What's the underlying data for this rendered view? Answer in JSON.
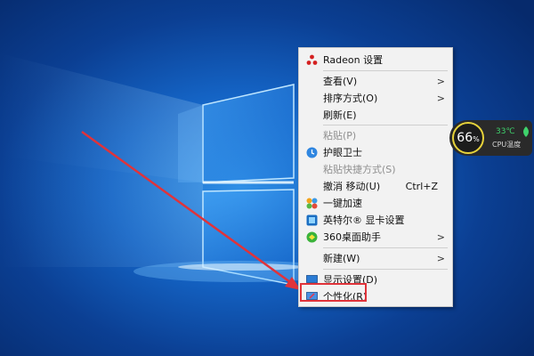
{
  "menu": {
    "items": [
      {
        "label": "Radeon 设置",
        "icon": "radeon-icon"
      },
      {
        "label": "查看(V)",
        "submenu": true
      },
      {
        "label": "排序方式(O)",
        "submenu": true
      },
      {
        "label": "刷新(E)"
      },
      {
        "label": "粘贴(P)",
        "disabled": true
      },
      {
        "label": "护眼卫士",
        "icon": "eye-care-icon"
      },
      {
        "label": "粘贴快捷方式(S)",
        "disabled": true
      },
      {
        "label": "撤消 移动(U)",
        "shortcut": "Ctrl+Z"
      },
      {
        "label": "一键加速",
        "icon": "speedup-icon"
      },
      {
        "label": "英特尔® 显卡设置",
        "icon": "intel-graphics-icon"
      },
      {
        "label": "360桌面助手",
        "icon": "360-desktop-icon",
        "submenu": true
      },
      {
        "label": "新建(W)",
        "submenu": true
      },
      {
        "label": "显示设置(D)",
        "icon": "display-icon"
      },
      {
        "label": "个性化(R)",
        "icon": "personalize-icon"
      }
    ],
    "submenu_arrow": ">"
  },
  "temp_widget": {
    "usage": "66",
    "usage_unit": "%",
    "temperature": "33℃",
    "label": "CPU温度"
  },
  "colors": {
    "highlight_border": "#e0333a",
    "arrow": "#e0333a",
    "ring": "#e6d23a",
    "temperature": "#3fd26c"
  }
}
